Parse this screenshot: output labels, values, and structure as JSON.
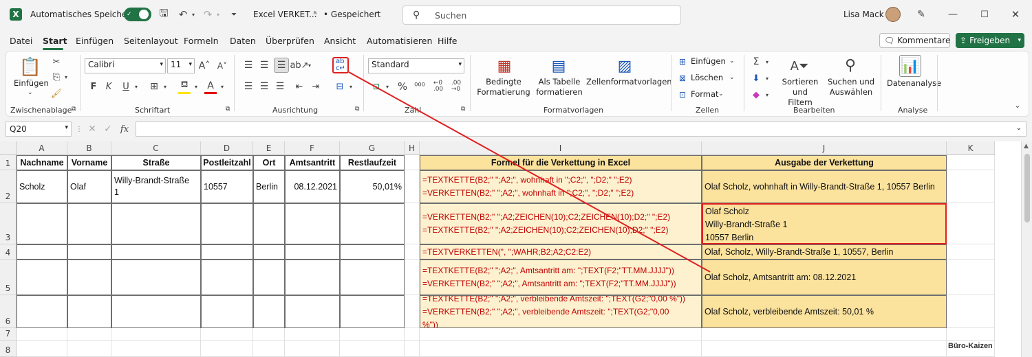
{
  "titlebar": {
    "autosave_label": "Automatisches Speichern",
    "autosave_state": "on",
    "filename": "Excel VERKET...",
    "save_status": "• Gespeichert",
    "search_placeholder": "Suchen",
    "user_name": "Lisa Mack"
  },
  "menu": [
    "Datei",
    "Start",
    "Einfügen",
    "Seitenlayout",
    "Formeln",
    "Daten",
    "Überprüfen",
    "Ansicht",
    "Automatisieren",
    "Hilfe"
  ],
  "menu_active": "Start",
  "menu_right": {
    "comments": "Kommentare",
    "share": "Freigeben"
  },
  "ribbon": {
    "paste": "Einfügen",
    "font_name": "Calibri",
    "font_size": "11",
    "number_format": "Standard",
    "cond_format": "Bedingte\nFormatierung",
    "as_table": "Als Tabelle\nformatieren",
    "cell_styles": "Zellenformatvorlagen",
    "insert": "Einfügen",
    "delete": "Löschen",
    "format": "Format",
    "sort_filter": "Sortieren und\nFiltern",
    "find_select": "Suchen und\nAuswählen",
    "data_analysis": "Datenanalyse",
    "groups": [
      "Zwischenablage",
      "Schriftart",
      "Ausrichtung",
      "Zahl",
      "Formatvorlagen",
      "Zellen",
      "Bearbeiten",
      "Analyse"
    ]
  },
  "formula_bar": {
    "name_box": "Q20",
    "fx": "fx",
    "content": ""
  },
  "columns": [
    "A",
    "B",
    "C",
    "D",
    "E",
    "F",
    "G",
    "H",
    "I",
    "J",
    "K"
  ],
  "rows": [
    "1",
    "2",
    "3",
    "4",
    "5",
    "6",
    "7",
    "8"
  ],
  "headers": {
    "A1": "Nachname",
    "B1": "Vorname",
    "C1": "Straße",
    "D1": "Postleitzahl",
    "E1": "Ort",
    "F1": "Amtsantritt",
    "G1": "Restlaufzeit",
    "I1": "Formel für die Verkettung in Excel",
    "J1": "Ausgabe der Verkettung"
  },
  "data_row": {
    "A2": "Scholz",
    "B2": "Olaf",
    "C2": "Willy-Brandt-Straße\n1",
    "D2": "10557",
    "E2": "Berlin",
    "F2": "08.12.2021",
    "G2": "50,01%"
  },
  "formulas": {
    "I2": "=TEXTKETTE(B2;\" \";A2;\", wohnhaft in \";C2;\", \";D2;\" \";E2)\n=VERKETTEN(B2;\" \";A2;\", wohnhaft in \";C2;\", \";D2;\" \";E2)",
    "I3": "=VERKETTEN(B2;\" \";A2;ZEICHEN(10);C2;ZEICHEN(10);D2;\" \";E2)\n=TEXTKETTE(B2;\" \";A2;ZEICHEN(10);C2;ZEICHEN(10);D2;\" \";E2)",
    "I4": "=TEXTVERKETTEN(\", \";WAHR;B2;A2;C2:E2)",
    "I5": "=TEXTKETTE(B2;\" \";A2;\", Amtsantritt am: \";TEXT(F2;\"TT.MM.JJJJ\"))\n=VERKETTEN(B2;\" \";A2;\", Amtsantritt am: \";TEXT(F2;\"TT.MM.JJJJ\"))",
    "I6": "=TEXTKETTE(B2;\" \";A2;\", verbleibende Amtszeit: \";TEXT(G2;\"0,00 %\"))\n=VERKETTEN(B2;\" \";A2;\", verbleibende Amtszeit: \";TEXT(G2;\"0,00\n%\"))"
  },
  "outputs": {
    "J2": "Olaf Scholz, wohnhaft in Willy-Brandt-Straße 1, 10557 Berlin",
    "J3": "Olaf Scholz\nWilly-Brandt-Straße 1\n10557 Berlin",
    "J4": "Olaf, Scholz, Willy-Brandt-Straße 1, 10557, Berlin",
    "J5": "Olaf Scholz, Amtsantritt am: 08.12.2021",
    "J6": "Olaf Scholz, verbleibende Amtszeit: 50,01 %"
  },
  "watermark": "Büro-Kaizen",
  "colors": {
    "excel_green": "#217346",
    "accent_red": "#e02020",
    "formula_fill": "#fdf1cf",
    "output_fill": "#fbe29d",
    "formula_text": "#c00000"
  }
}
